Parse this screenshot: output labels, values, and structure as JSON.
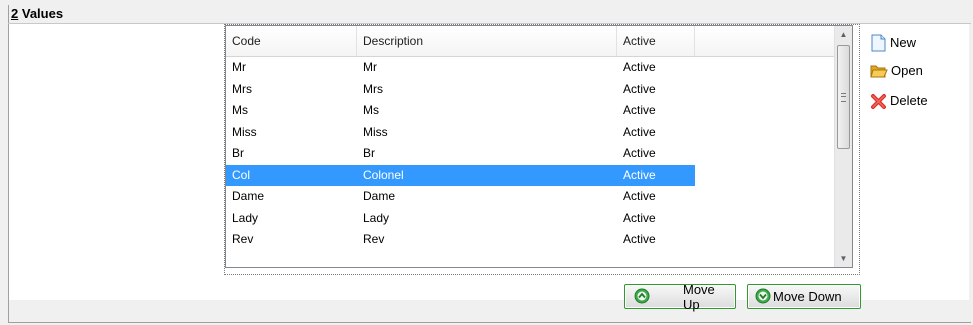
{
  "section": {
    "number": "2",
    "title": "Values"
  },
  "list": {
    "columns": [
      "Code",
      "Description",
      "Active"
    ],
    "rows": [
      {
        "code": "Mr",
        "description": "Mr",
        "active": "Active"
      },
      {
        "code": "Mrs",
        "description": "Mrs",
        "active": "Active"
      },
      {
        "code": "Ms",
        "description": "Ms",
        "active": "Active"
      },
      {
        "code": "Miss",
        "description": "Miss",
        "active": "Active"
      },
      {
        "code": "Br",
        "description": "Br",
        "active": "Active"
      },
      {
        "code": "Col",
        "description": "Colonel",
        "active": "Active"
      },
      {
        "code": "Dame",
        "description": "Dame",
        "active": "Active"
      },
      {
        "code": "Lady",
        "description": "Lady",
        "active": "Active"
      },
      {
        "code": "Rev",
        "description": "Rev",
        "active": "Active"
      }
    ],
    "selected_row": 5
  },
  "actions": {
    "new_label": "New",
    "open_label": "Open",
    "delete_label": "Delete"
  },
  "buttons": {
    "move_up_label": "Move Up",
    "move_down_label": "Move Down"
  },
  "colors": {
    "selection": "#3399ff",
    "button_border": "#2f9a2f"
  }
}
